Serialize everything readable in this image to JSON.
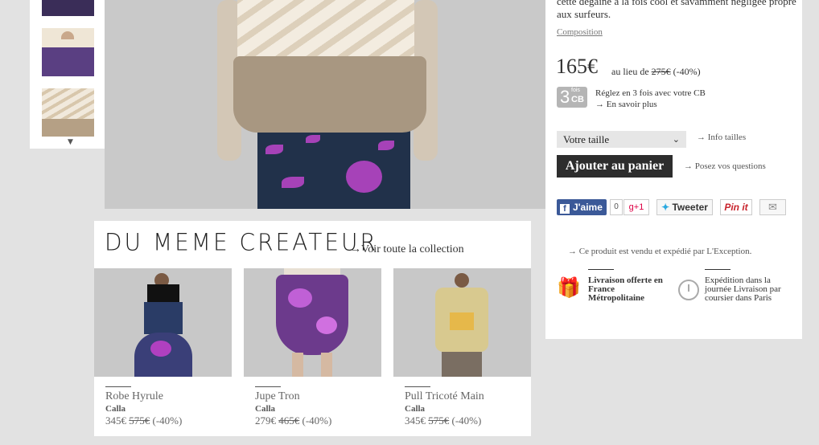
{
  "product": {
    "description": "cette dégaine à la fois cool et savamment négligée propre aux surfeurs.",
    "composition_link": "Composition",
    "price": "165€",
    "instead_of_label": "au lieu de",
    "old_price": "275€",
    "discount": "(-40%)",
    "installments_badge": {
      "number": "3",
      "fois": "fois",
      "cb": "CB"
    },
    "installments_text": "Réglez en 3 fois avec votre CB",
    "installments_more": "→ En savoir plus",
    "size_select_value": "Votre taille",
    "size_info_link": "→ Info tailles",
    "add_to_cart": "Ajouter au panier",
    "ask_questions": "→ Posez vos questions"
  },
  "social": {
    "facebook_label": "J'aime",
    "facebook_count": "0",
    "gplus_label": "g+1",
    "twitter_label": "Tweeter",
    "pinterest_label": "Pin it",
    "mail_icon": "mail-icon"
  },
  "shipping": {
    "sold_by": "→ Ce produit est vendu et expédié par L'Exception.",
    "free_delivery": "Livraison offerte en France Métropolitaine",
    "same_day": "Expédition dans la journée Livraison par coursier dans Paris"
  },
  "related": {
    "title": "DU MEME CREATEUR",
    "see_all": "→Voir toute la collection",
    "items": [
      {
        "name": "Robe Hyrule",
        "brand": "Calla",
        "price": "345€",
        "old_price": "575€",
        "discount": "(-40%)"
      },
      {
        "name": "Jupe Tron",
        "brand": "Calla",
        "price": "279€",
        "old_price": "465€",
        "discount": "(-40%)"
      },
      {
        "name": "Pull Tricoté Main",
        "brand": "Calla",
        "price": "345€",
        "old_price": "575€",
        "discount": "(-40%)"
      }
    ]
  },
  "colors": {
    "cart_button": "#2d2d2d",
    "facebook": "#3b5998",
    "background": "#e2e2e2"
  }
}
